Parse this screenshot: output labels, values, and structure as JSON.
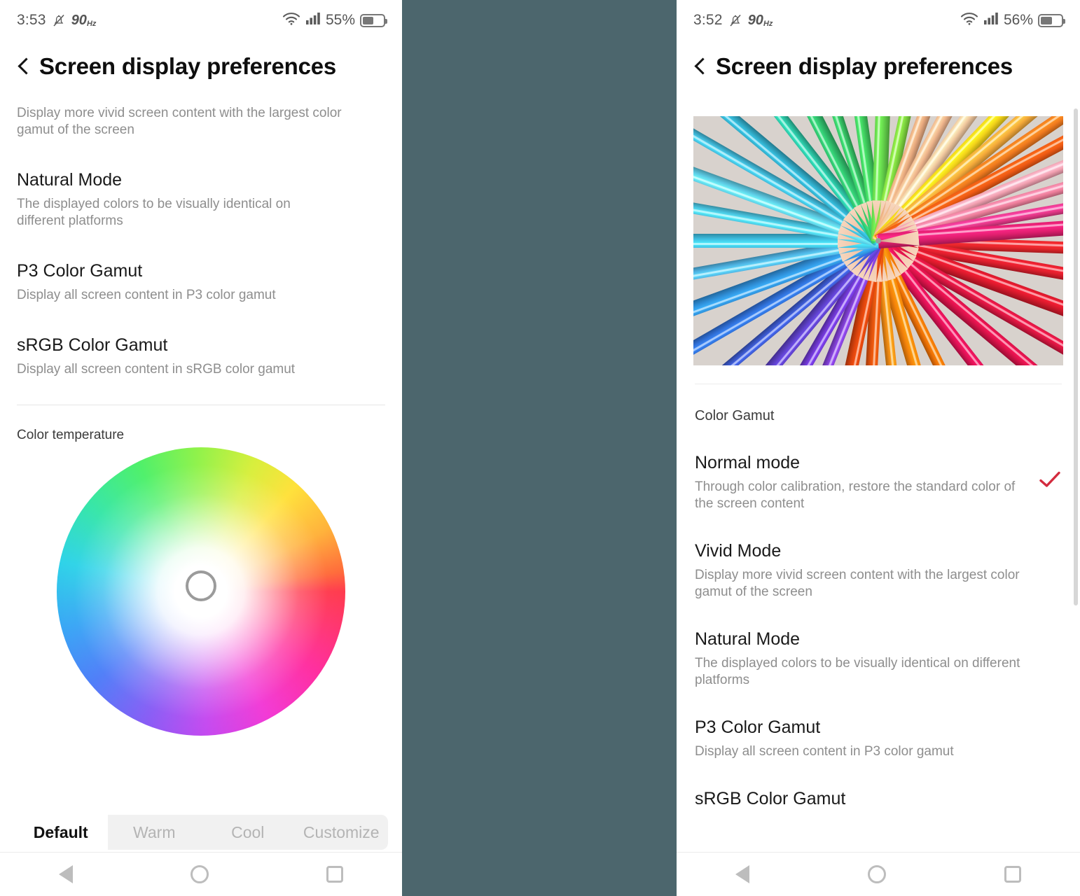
{
  "background_color": "#4c666d",
  "accent_color": "#d32b3e",
  "left_phone": {
    "status_bar": {
      "time": "3:53",
      "mute_icon": "bell-muted-icon",
      "refresh_rate": "90",
      "refresh_rate_unit": "Hz",
      "wifi_icon": "wifi-icon",
      "signal_icon": "cellular-signal-icon",
      "battery_percent": "55%",
      "battery_icon": "battery-icon"
    },
    "header": {
      "back_icon": "back-chevron-icon",
      "title": "Screen display preferences"
    },
    "lead_text": "Display more vivid screen content with the largest color gamut of the screen",
    "options": [
      {
        "title": "Natural Mode",
        "desc": "The displayed colors to be visually identical on different platforms"
      },
      {
        "title": "P3 Color Gamut",
        "desc": "Display all screen content in P3 color gamut"
      },
      {
        "title": "sRGB Color Gamut",
        "desc": "Display all screen content in sRGB color gamut"
      }
    ],
    "color_temperature": {
      "label": "Color temperature",
      "wheel_icon": "hsv-color-wheel",
      "selector_icon": "color-selector-knob"
    },
    "tabs": [
      {
        "label": "Default",
        "selected": true
      },
      {
        "label": "Warm",
        "selected": false
      },
      {
        "label": "Cool",
        "selected": false
      },
      {
        "label": "Customize",
        "selected": false
      }
    ],
    "nav_bar": {
      "back": "nav-back-icon",
      "home": "nav-home-icon",
      "recents": "nav-recents-icon"
    }
  },
  "right_phone": {
    "status_bar": {
      "time": "3:52",
      "mute_icon": "bell-muted-icon",
      "refresh_rate": "90",
      "refresh_rate_unit": "Hz",
      "wifi_icon": "wifi-icon",
      "signal_icon": "cellular-signal-icon",
      "battery_percent": "56%",
      "battery_icon": "battery-icon"
    },
    "header": {
      "back_icon": "back-chevron-icon",
      "title": "Screen display preferences"
    },
    "hero_image": "colored-pencils-radial-photo",
    "section_label": "Color Gamut",
    "options": [
      {
        "title": "Normal mode",
        "desc": "Through color calibration, restore the standard color of the screen content",
        "selected": true
      },
      {
        "title": "Vivid Mode",
        "desc": "Display more vivid screen content with the largest color gamut of the screen",
        "selected": false
      },
      {
        "title": "Natural Mode",
        "desc": "The displayed colors to be visually identical on different platforms",
        "selected": false
      },
      {
        "title": "P3 Color Gamut",
        "desc": "Display all screen content in P3 color gamut",
        "selected": false
      },
      {
        "title": "sRGB Color Gamut",
        "desc": "",
        "selected": false
      }
    ],
    "scrollbar": "vertical-scrollbar",
    "nav_bar": {
      "back": "nav-back-icon",
      "home": "nav-home-icon",
      "recents": "nav-recents-icon"
    }
  }
}
